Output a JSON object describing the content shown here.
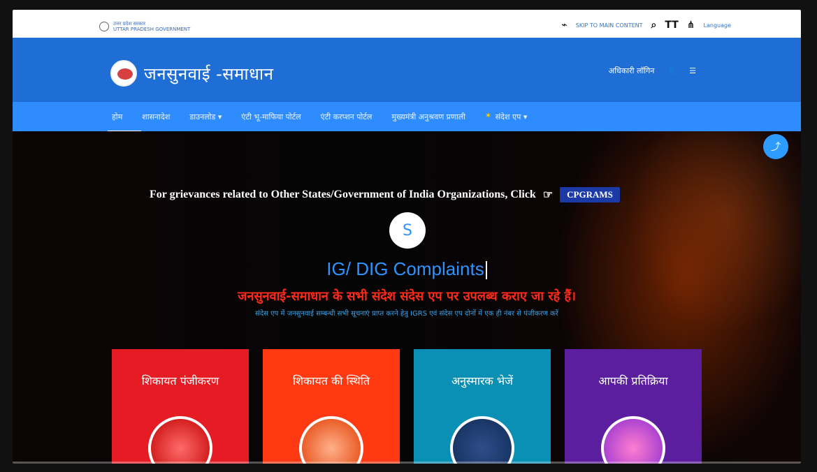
{
  "topbar": {
    "gov_line1": "उत्तर प्रदेश सरकार",
    "gov_line2": "UTTAR PRADESH GOVERNMENT",
    "skip_label": "SKIP TO MAIN CONTENT",
    "text_size_label": "TT",
    "language_label": "Language"
  },
  "header": {
    "site_title": "जनसुनवाई -समाधान",
    "officer_login": "अधिकारी लॉगिन"
  },
  "nav": {
    "items": [
      {
        "label": "होम"
      },
      {
        "label": "शासनादेश"
      },
      {
        "label": "डाउनलोड ▾"
      },
      {
        "label": "एंटी भू-माफिया पोर्टल"
      },
      {
        "label": "एंटी करप्शन पोर्टल"
      },
      {
        "label": "मुख्यमंत्री अनुश्रवण प्रणाली"
      },
      {
        "label": "संदेश एप ▾"
      }
    ]
  },
  "hero": {
    "notice_text": "For grievances related to Other States/Government of India Organizations, Click",
    "cpgrams_label": "CPGRAMS",
    "badge_letter": "S",
    "headline": "IG/ DIG Complaints",
    "hindi_notice": "जनसुनवाई-समाधान के सभी संदेश संदेस एप पर उपलब्ध कराए जा रहे हैं।",
    "hindi_subtext": "संदेस एप में जनसुनवाई सम्बन्धी सभी सूचनाएं प्राप्त करने हेतु IGRS एवं संदेस एप दोनों में एक ही नंबर से पंजीकरण करें"
  },
  "cards": [
    {
      "label": "शिकायत पंजीकरण"
    },
    {
      "label": "शिकायत की स्थिति"
    },
    {
      "label": "अनुस्मारक भेजें"
    },
    {
      "label": "आपकी प्रतिक्रिया"
    }
  ],
  "colors": {
    "header_blue": "#1f6ed6",
    "nav_blue": "#2f8cff",
    "card_red": "#e61c25",
    "card_orange": "#ff3a12",
    "card_teal": "#0a8fb5",
    "card_purple": "#5a1e9f"
  }
}
